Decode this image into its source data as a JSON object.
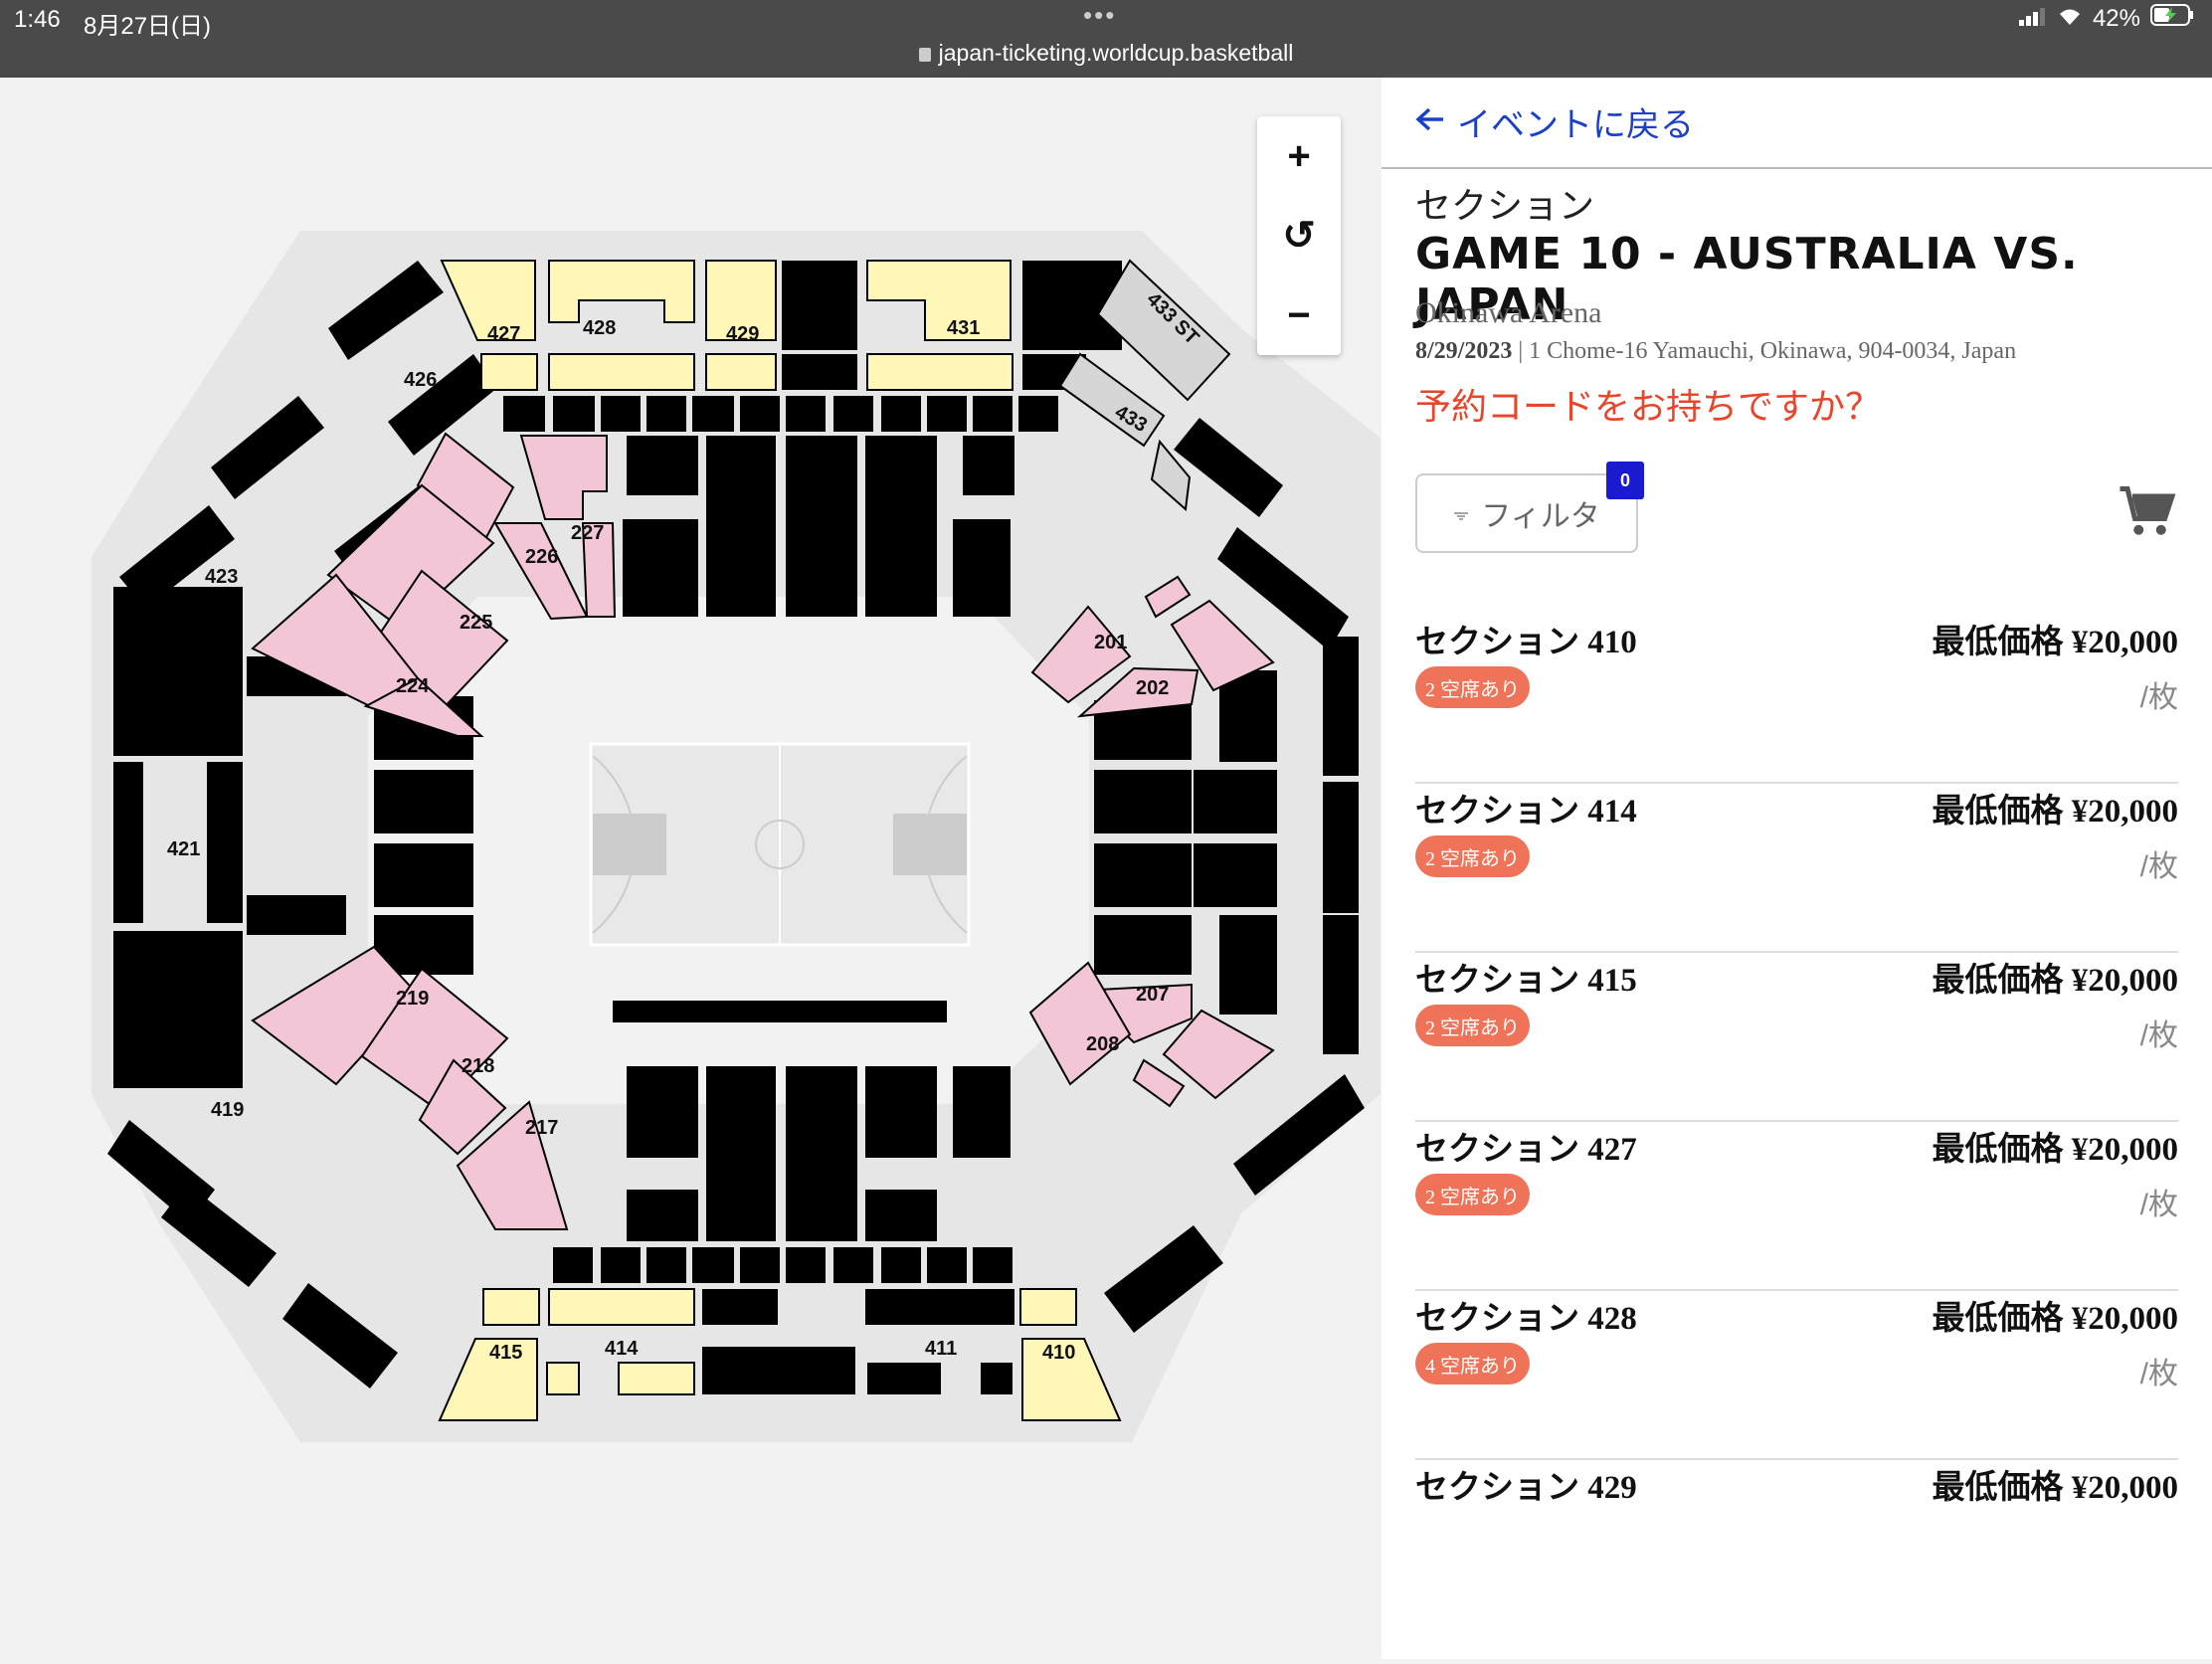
{
  "status": {
    "time": "1:46",
    "date": "8月27日(日)",
    "dots": "•••",
    "battery": "42%",
    "url": "japan-ticketing.worldcup.basketball"
  },
  "map": {
    "zoom_in": "+",
    "reset": "↺",
    "zoom_out": "−",
    "labels": [
      "427",
      "428",
      "429",
      "431",
      "433 ST",
      "433",
      "426",
      "423",
      "227",
      "226",
      "225",
      "224",
      "201",
      "202",
      "421",
      "219",
      "218",
      "217",
      "207",
      "208",
      "419",
      "415",
      "414",
      "411",
      "410"
    ]
  },
  "panel": {
    "back_label": "イベントに戻る",
    "section_label": "セクション",
    "game_title": "GAME 10 - AUSTRALIA VS. JAPAN",
    "venue": "Okinawa Arena",
    "date": "8/29/2023",
    "address": " | 1 Chome-16 Yamauchi, Okinawa, 904-0034, Japan",
    "promo": "予約コードをお持ちですか？",
    "filter_label": "フィルタ",
    "filter_count": "0",
    "sections": [
      {
        "name": "セクション 410",
        "price": "最低価格 ¥20,000",
        "seats": "2 空席あり",
        "unit": "/枚"
      },
      {
        "name": "セクション 414",
        "price": "最低価格 ¥20,000",
        "seats": "2 空席あり",
        "unit": "/枚"
      },
      {
        "name": "セクション 415",
        "price": "最低価格 ¥20,000",
        "seats": "2 空席あり",
        "unit": "/枚"
      },
      {
        "name": "セクション 427",
        "price": "最低価格 ¥20,000",
        "seats": "2 空席あり",
        "unit": "/枚"
      },
      {
        "name": "セクション 428",
        "price": "最低価格 ¥20,000",
        "seats": "4 空席あり",
        "unit": "/枚"
      },
      {
        "name": "セクション 429",
        "price": "最低価格 ¥20,000",
        "seats": "",
        "unit": ""
      }
    ]
  },
  "colors": {
    "available_upper": "#fff7b8",
    "available_lower": "#f2c6d6",
    "sold": "#000000",
    "accent_blue": "#1a40c8",
    "promo_red": "#e8452b",
    "badge": "#ef7358"
  }
}
